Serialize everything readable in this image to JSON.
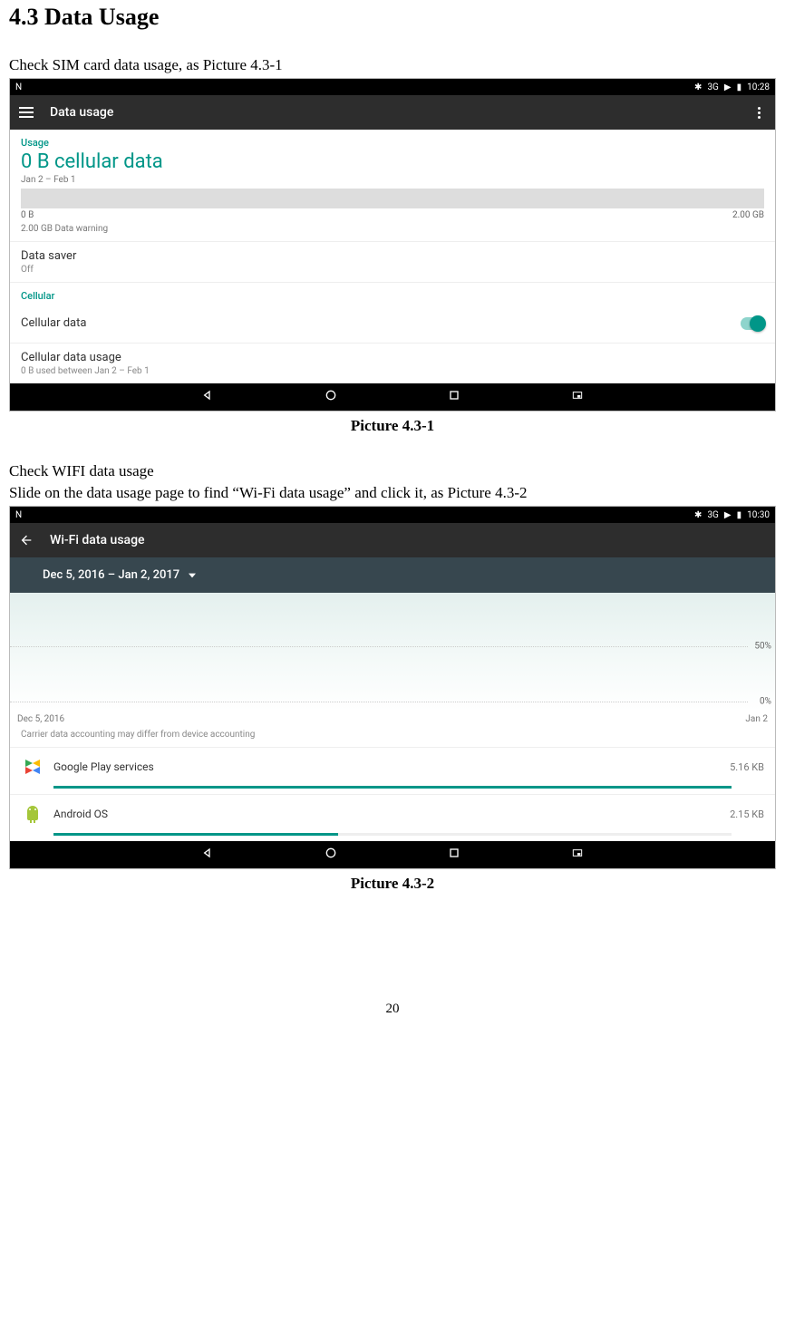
{
  "doc": {
    "section_title": "4.3    Data Usage",
    "intro1": "Check SIM card data usage, as Picture 4.3-1",
    "caption1": "Picture 4.3-1",
    "intro2a": "Check WIFI data usage",
    "intro2b": "Slide on the data usage page to find “Wi-Fi data usage” and click it, as Picture 4.3-2",
    "caption2": "Picture 4.3-2",
    "page_num": "20"
  },
  "shot1": {
    "status_left": "N",
    "status_right": {
      "bt": "✱",
      "net": "3G",
      "sig": "▶",
      "bat": "▮",
      "time": "10:28"
    },
    "appbar_title": "Data usage",
    "usage_label": "Usage",
    "usage_amount": "0 B cellular data",
    "usage_range": "Jan 2 – Feb 1",
    "bar_min": "0 B",
    "bar_max": "2.00 GB",
    "bar_warn": "2.00 GB Data warning",
    "datasaver_title": "Data saver",
    "datasaver_value": "Off",
    "cellular_label": "Cellular",
    "cellular_data_row": "Cellular data",
    "cdu_title": "Cellular data usage",
    "cdu_sub": "0 B used between Jan 2 – Feb 1"
  },
  "shot2": {
    "status_left": "N",
    "status_right": {
      "bt": "✱",
      "net": "3G",
      "sig": "▶",
      "bat": "▮",
      "time": "10:30"
    },
    "appbar_title": "Wi-Fi data usage",
    "date_range": "Dec 5, 2016 – Jan 2, 2017",
    "x_start": "Dec 5, 2016",
    "x_end": "Jan 2",
    "y50": "50%",
    "y0": "0%",
    "note": "Carrier data accounting may differ from device accounting",
    "apps": [
      {
        "name": "Google Play services",
        "size": "5.16 KB",
        "pct": 100
      },
      {
        "name": "Android OS",
        "size": "2.15 KB",
        "pct": 42
      }
    ]
  },
  "chart_data": [
    {
      "type": "bar",
      "title": "Cellular data usage",
      "categories": [
        "Jan 2 – Feb 1"
      ],
      "values": [
        0
      ],
      "ylim": [
        0,
        2.0
      ],
      "yunit": "GB",
      "warning_at": 2.0
    },
    {
      "type": "line",
      "title": "Wi-Fi data usage",
      "x": [
        "Dec 5, 2016",
        "Jan 2"
      ],
      "series": [
        {
          "name": "usage_pct",
          "values": [
            0,
            0
          ]
        }
      ],
      "ylim": [
        0,
        100
      ],
      "yunit": "%",
      "yticks": [
        0,
        50
      ]
    },
    {
      "type": "bar",
      "title": "Wi-Fi usage by app",
      "categories": [
        "Google Play services",
        "Android OS"
      ],
      "values": [
        5.16,
        2.15
      ],
      "yunit": "KB"
    }
  ]
}
